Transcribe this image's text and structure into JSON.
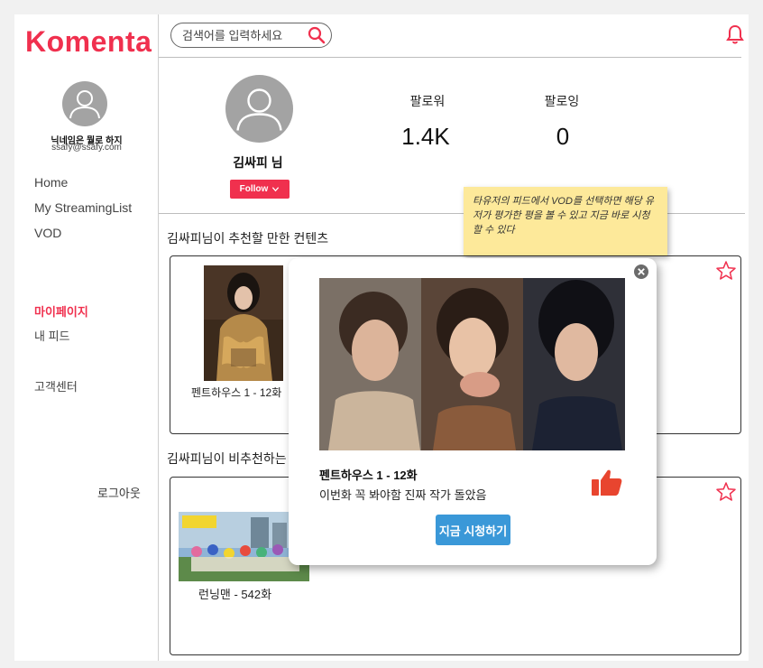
{
  "app": {
    "logo": "Komenta"
  },
  "sidebar": {
    "nickname": "닉네임은 뭘로 하지",
    "email": "ssafy@ssafy.com",
    "nav": [
      {
        "label": "Home"
      },
      {
        "label": "My StreamingList"
      },
      {
        "label": "VOD"
      },
      {
        "label": "마이페이지",
        "active": true
      },
      {
        "label": "내 피드"
      },
      {
        "label": "고객센터"
      }
    ],
    "logout_label": "로그아웃"
  },
  "search": {
    "placeholder": "검색어를 입력하세요"
  },
  "profile": {
    "name": "김싸피 님",
    "follow_label": "Follow",
    "followers_label": "팔로워",
    "followers_value": "1.4K",
    "following_label": "팔로잉",
    "following_value": "0"
  },
  "tooltip": {
    "text": "타유저의 피드에서 VOD를 선택하면 해당 유저가 평가한 평을 볼 수 있고 지금 바로 시청할 수 있다"
  },
  "sections": {
    "recommended": {
      "title": "김싸피님이 추천할 만한 컨텐츠",
      "items": [
        {
          "caption": "펜트하우스 1 - 12화"
        }
      ]
    },
    "not_recommended": {
      "title": "김싸피님이  비추천하는",
      "items": [
        {
          "caption": "런닝맨 - 542화"
        }
      ]
    }
  },
  "modal": {
    "title": "펜트하우스 1 - 12화",
    "comment": "이번화 꼭 봐야함 진짜 작가 돌았음",
    "watch_label": "지금 시청하기",
    "rating_icon": "thumbs-up-icon"
  },
  "colors": {
    "brand": "#f0304e",
    "watch_button": "#3a98d8",
    "tooltip": "#fde99a",
    "thumb": "#e8452f"
  }
}
